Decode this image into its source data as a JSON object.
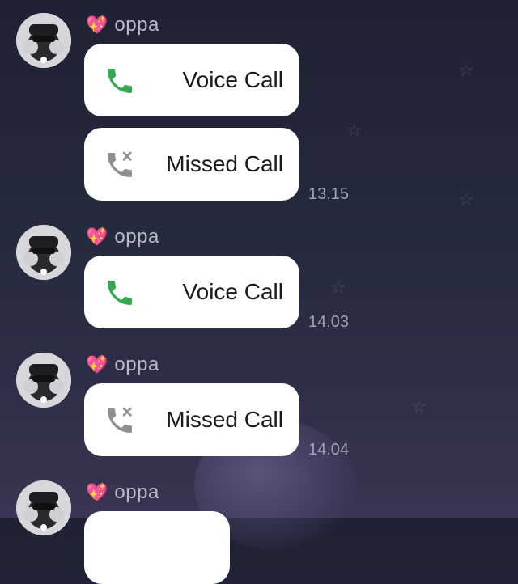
{
  "messages": [
    {
      "sender": "oppa",
      "heart": "💖",
      "calls": [
        {
          "type": "voice",
          "label": "Voice Call",
          "icon": "phone-icon",
          "icon_color": "#34a853"
        },
        {
          "type": "missed",
          "label": "Missed Call",
          "icon": "missed-call-icon",
          "icon_color": "#8e8e93"
        }
      ],
      "time": "13.15"
    },
    {
      "sender": "oppa",
      "heart": "💖",
      "calls": [
        {
          "type": "voice",
          "label": "Voice Call",
          "icon": "phone-icon",
          "icon_color": "#34a853"
        }
      ],
      "time": "14.03"
    },
    {
      "sender": "oppa",
      "heart": "💖",
      "calls": [
        {
          "type": "missed",
          "label": "Missed Call",
          "icon": "missed-call-icon",
          "icon_color": "#8e8e93"
        }
      ],
      "time": "14.04"
    },
    {
      "sender": "oppa",
      "heart": "💖"
    }
  ],
  "colors": {
    "background": "#262a3d",
    "bubble": "#ffffff",
    "voice_icon": "#34a853",
    "missed_icon": "#8e8e93",
    "sender_text": "#b8bcc9",
    "time_text": "#9ea3b2"
  }
}
